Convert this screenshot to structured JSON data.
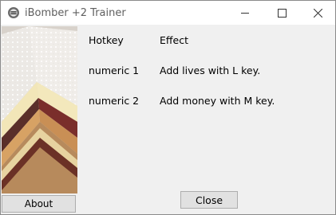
{
  "window": {
    "title": "iBomber +2 Trainer",
    "controls": {
      "minimize_icon": "minimize-icon",
      "maximize_icon": "maximize-icon",
      "close_icon": "close-x-icon"
    }
  },
  "sidebar": {
    "image": "cake-slice-picture",
    "about_label": "About"
  },
  "hotkeys": {
    "headers": {
      "hotkey": "Hotkey",
      "effect": "Effect"
    },
    "rows": [
      {
        "hotkey": "numeric 1",
        "effect": "Add lives with L key."
      },
      {
        "hotkey": "numeric 2",
        "effect": "Add money with M key."
      }
    ]
  },
  "footer": {
    "close_label": "Close"
  }
}
